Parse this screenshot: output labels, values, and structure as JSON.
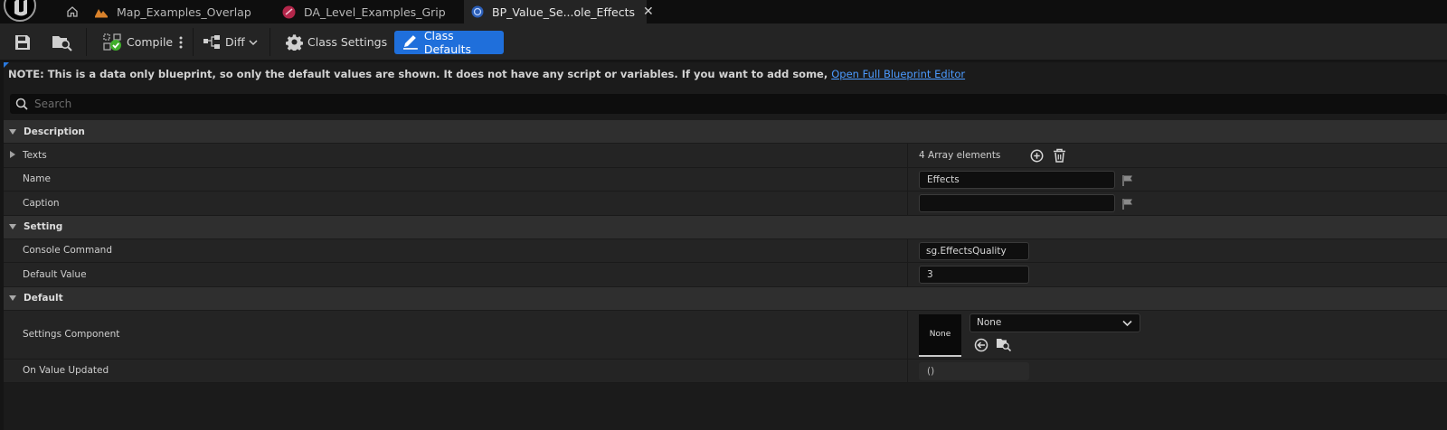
{
  "tabs": [
    {
      "label": "Map_Examples_Overlap",
      "icon": "level-map-icon"
    },
    {
      "label": "DA_Level_Examples_Grip",
      "icon": "data-asset-icon"
    },
    {
      "label": "BP_Value_Se...ole_Effects",
      "icon": "blueprint-icon",
      "active": true
    }
  ],
  "toolbar": {
    "compile_label": "Compile",
    "diff_label": "Diff",
    "class_settings_label": "Class Settings",
    "class_defaults_label": "Class Defaults"
  },
  "note": {
    "text": "NOTE: This is a data only blueprint, so only the default values are shown.  It does not have any script or variables.  If you want to add some,",
    "link": "Open Full Blueprint Editor"
  },
  "search": {
    "placeholder": "Search"
  },
  "categories": {
    "description": "Description",
    "setting": "Setting",
    "default": "Default"
  },
  "properties": {
    "texts": {
      "label": "Texts",
      "value": "4 Array elements"
    },
    "name": {
      "label": "Name",
      "value": "Effects"
    },
    "caption": {
      "label": "Caption",
      "value": ""
    },
    "console_command": {
      "label": "Console Command",
      "value": "sg.EffectsQuality"
    },
    "default_value": {
      "label": "Default Value",
      "value": "3"
    },
    "settings_component": {
      "label": "Settings Component",
      "thumb": "None",
      "value": "None"
    },
    "on_value_updated": {
      "label": "On Value Updated",
      "value": "()"
    }
  },
  "colors": {
    "accent": "#1f6fdb",
    "link": "#4c9bff"
  }
}
